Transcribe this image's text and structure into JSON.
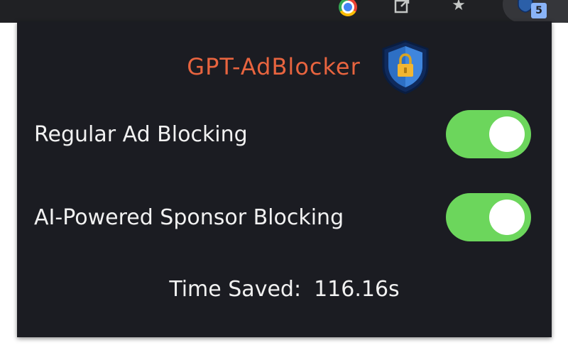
{
  "browser": {
    "toolbar_icons": [
      "chrome-icon",
      "share-icon",
      "bookmark-star-icon"
    ],
    "extension_badge": "5"
  },
  "popup": {
    "title": "GPT-AdBlocker",
    "logo_icon": "shield-lock-icon",
    "settings": [
      {
        "label": "Regular Ad Blocking",
        "enabled": true
      },
      {
        "label": "AI-Powered Sponsor Blocking",
        "enabled": true
      }
    ],
    "time_saved_label": "Time Saved:",
    "time_saved_value": "116.16s"
  },
  "colors": {
    "popup_bg": "#1b1c22",
    "title": "#e8643f",
    "toggle_on": "#6cd65c",
    "text": "#f1f1f1"
  }
}
